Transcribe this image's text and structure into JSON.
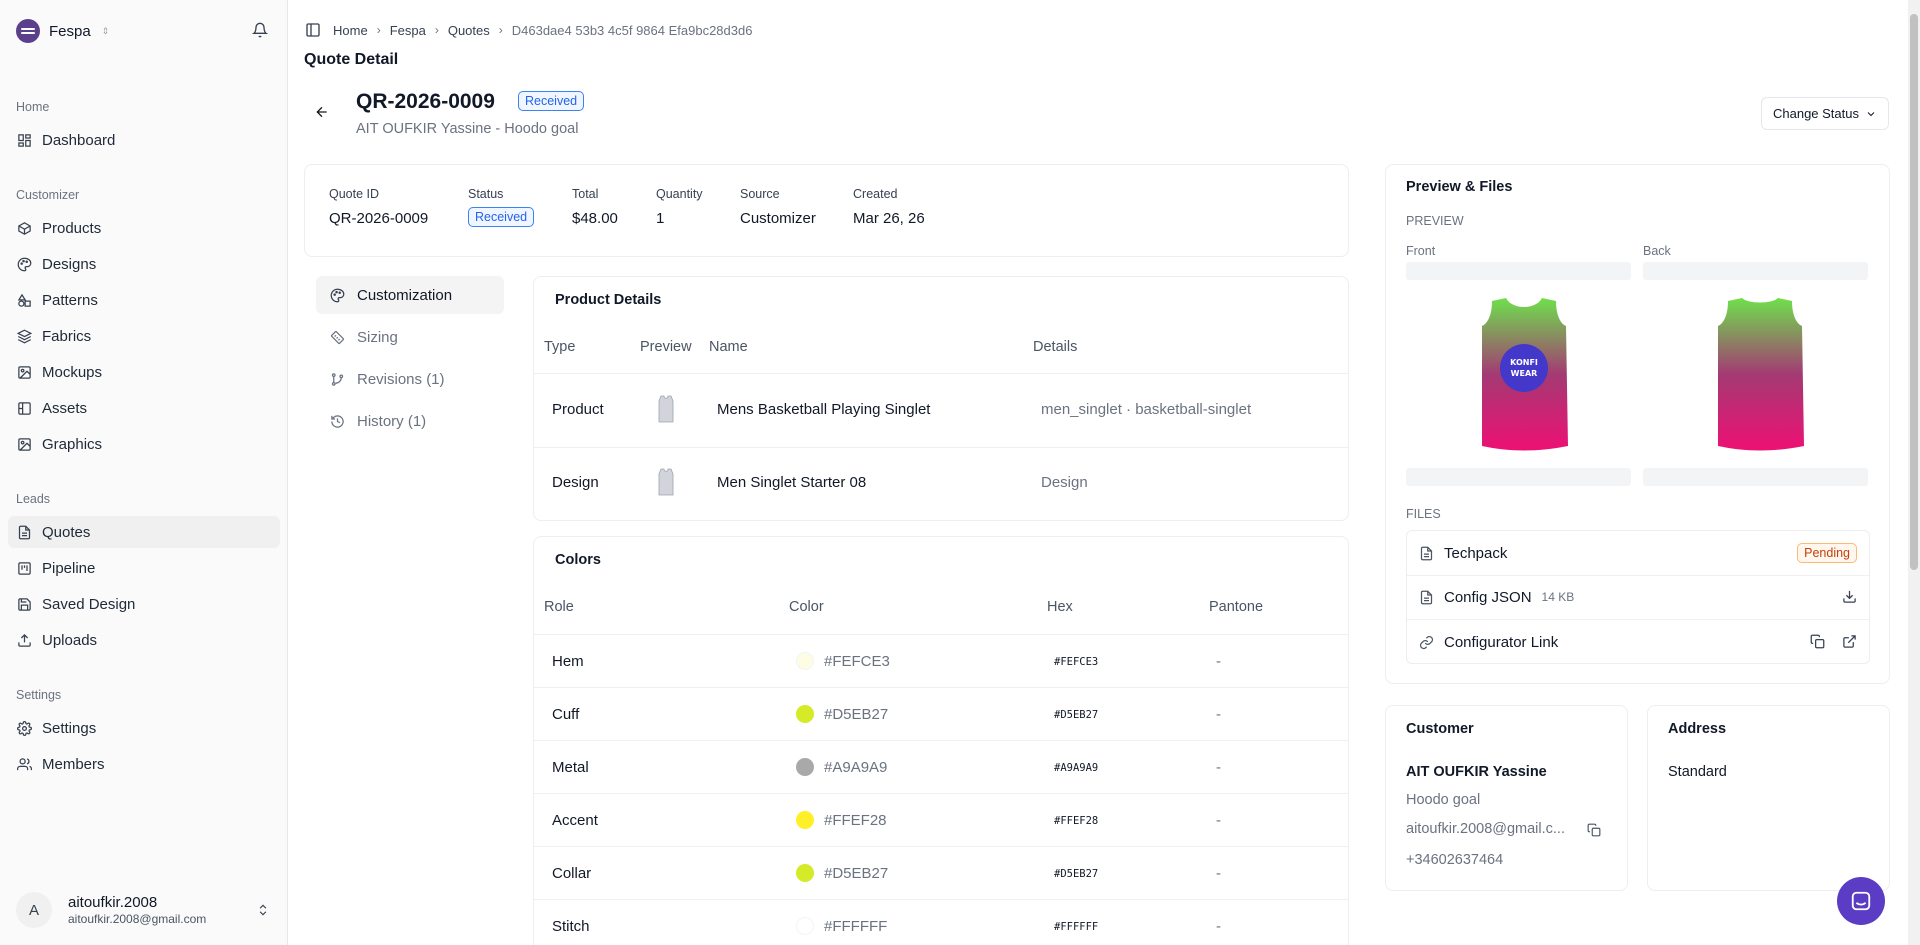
{
  "brand": {
    "name": "Fespa"
  },
  "sidebar": {
    "sections": [
      {
        "label": "Home",
        "items": [
          {
            "label": "Dashboard",
            "icon": "dashboard-icon"
          }
        ]
      },
      {
        "label": "Customizer",
        "items": [
          {
            "label": "Products",
            "icon": "box-icon"
          },
          {
            "label": "Designs",
            "icon": "palette-icon"
          },
          {
            "label": "Patterns",
            "icon": "shapes-icon"
          },
          {
            "label": "Fabrics",
            "icon": "layers-icon"
          },
          {
            "label": "Mockups",
            "icon": "image-icon"
          },
          {
            "label": "Assets",
            "icon": "folder-icon"
          },
          {
            "label": "Graphics",
            "icon": "graphics-icon"
          }
        ]
      },
      {
        "label": "Leads",
        "items": [
          {
            "label": "Quotes",
            "icon": "file-icon",
            "active": true
          },
          {
            "label": "Pipeline",
            "icon": "kanban-icon"
          },
          {
            "label": "Saved Design",
            "icon": "save-icon"
          },
          {
            "label": "Uploads",
            "icon": "upload-icon"
          }
        ]
      },
      {
        "label": "Settings",
        "items": [
          {
            "label": "Settings",
            "icon": "gear-icon"
          },
          {
            "label": "Members",
            "icon": "users-icon"
          }
        ]
      }
    ],
    "user": {
      "initial": "A",
      "name": "aitoufkir.2008",
      "email": "aitoufkir.2008@gmail.com"
    }
  },
  "breadcrumb": [
    "Home",
    "Fespa",
    "Quotes",
    "D463dae4 53b3 4c5f 9864 Efa9bc28d3d6"
  ],
  "page_title": "Quote Detail",
  "quote": {
    "id": "QR-2026-0009",
    "status": "Received",
    "subtitle": "AIT OUFKIR Yassine - Hoodo goal",
    "change_status_label": "Change Status"
  },
  "summary": [
    {
      "label": "Quote ID",
      "value": "QR-2026-0009"
    },
    {
      "label": "Status",
      "value": "Received"
    },
    {
      "label": "Total",
      "value": "$48.00"
    },
    {
      "label": "Quantity",
      "value": "1"
    },
    {
      "label": "Source",
      "value": "Customizer"
    },
    {
      "label": "Created",
      "value": "Mar 26, 26"
    }
  ],
  "tabs": [
    {
      "label": "Customization",
      "icon": "palette-icon",
      "active": true
    },
    {
      "label": "Sizing",
      "icon": "ruler-icon"
    },
    {
      "label": "Revisions (1)",
      "icon": "git-branch-icon"
    },
    {
      "label": "History (1)",
      "icon": "history-icon"
    }
  ],
  "product_details": {
    "title": "Product Details",
    "headers": [
      "Type",
      "Preview",
      "Name",
      "Details"
    ],
    "rows": [
      {
        "type": "Product",
        "name": "Mens Basketball Playing Singlet",
        "details": "men_singlet · basketball-singlet"
      },
      {
        "type": "Design",
        "name": "Men Singlet Starter 08",
        "details": "Design"
      }
    ]
  },
  "colors": {
    "title": "Colors",
    "headers": [
      "Role",
      "Color",
      "Hex",
      "Pantone"
    ],
    "rows": [
      {
        "role": "Hem",
        "color": "#FEFCE3",
        "hex": "#FEFCE3",
        "pantone": "-"
      },
      {
        "role": "Cuff",
        "color": "#D5EB27",
        "hex": "#D5EB27",
        "pantone": "-"
      },
      {
        "role": "Metal",
        "color": "#A9A9A9",
        "hex": "#A9A9A9",
        "pantone": "-"
      },
      {
        "role": "Accent",
        "color": "#FFEF28",
        "hex": "#FFEF28",
        "pantone": "-"
      },
      {
        "role": "Collar",
        "color": "#D5EB27",
        "hex": "#D5EB27",
        "pantone": "-"
      },
      {
        "role": "Stitch",
        "color": "#FFFFFF",
        "hex": "#FFFFFF",
        "pantone": "-"
      }
    ]
  },
  "preview": {
    "title": "Preview & Files",
    "preview_label": "PREVIEW",
    "front_label": "Front",
    "back_label": "Back",
    "logo_text": "KONFI WEAR",
    "files_label": "FILES",
    "files": [
      {
        "name": "Techpack",
        "badge": "Pending"
      },
      {
        "name": "Config JSON",
        "size": "14 KB"
      },
      {
        "name": "Configurator Link"
      }
    ]
  },
  "customer": {
    "title": "Customer",
    "name": "AIT OUFKIR Yassine",
    "company": "Hoodo goal",
    "email": "aitoufkir.2008@gmail.c...",
    "phone": "+34602637464"
  },
  "address": {
    "title": "Address",
    "value": "Standard"
  }
}
